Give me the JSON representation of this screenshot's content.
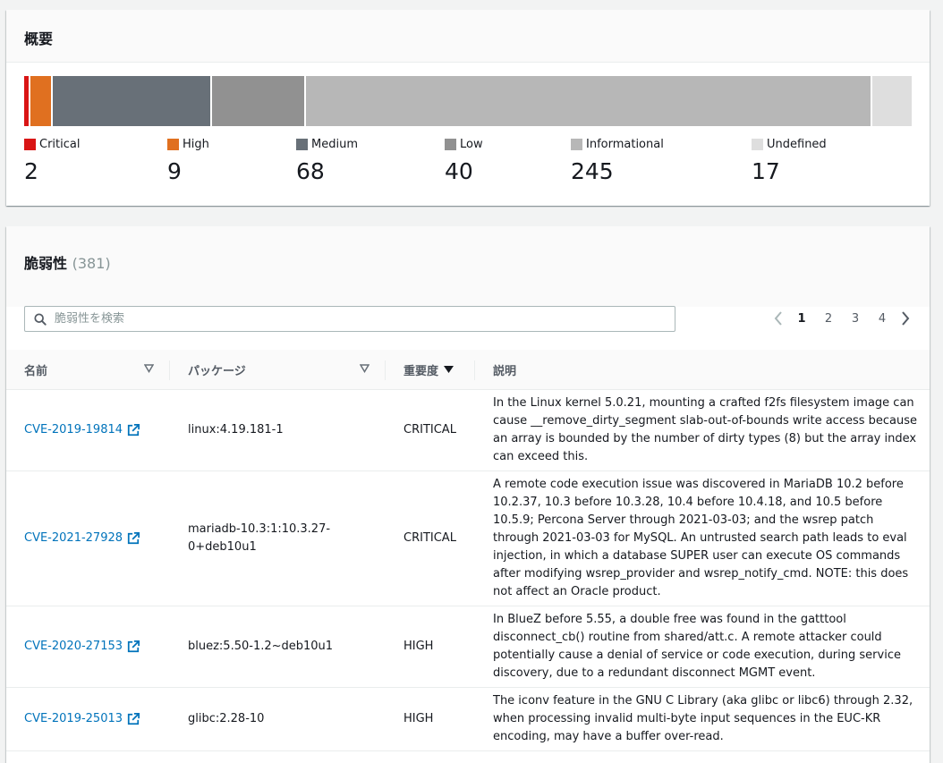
{
  "summary": {
    "title": "概要",
    "segments": [
      {
        "label": "Critical",
        "value": 2,
        "color": "#d91515"
      },
      {
        "label": "High",
        "value": 9,
        "color": "#e07020"
      },
      {
        "label": "Medium",
        "value": 68,
        "color": "#687078"
      },
      {
        "label": "Low",
        "value": 40,
        "color": "#919191"
      },
      {
        "label": "Informational",
        "value": 245,
        "color": "#b7b7b7"
      },
      {
        "label": "Undefined",
        "value": 17,
        "color": "#dedede"
      }
    ],
    "legend": [
      {
        "label": "Critical",
        "value": "2"
      },
      {
        "label": "High",
        "value": "9"
      },
      {
        "label": "Medium",
        "value": "68"
      },
      {
        "label": "Low",
        "value": "40"
      },
      {
        "label": "Informational",
        "value": "245"
      },
      {
        "label": "Undefined",
        "value": "17"
      }
    ]
  },
  "vulns": {
    "title": "脆弱性",
    "count": "(381)",
    "search_placeholder": "脆弱性を検索",
    "pages": [
      "1",
      "2",
      "3",
      "4"
    ],
    "current_page": "1",
    "columns": {
      "name": "名前",
      "package": "パッケージ",
      "severity": "重要度",
      "description": "説明"
    },
    "rows": [
      {
        "name": "CVE-2019-19814",
        "package": "linux:4.19.181-1",
        "severity": "CRITICAL",
        "description": "In the Linux kernel 5.0.21, mounting a crafted f2fs filesystem image can cause __remove_dirty_segment slab-out-of-bounds write access because an array is bounded by the number of dirty types (8) but the array index can exceed this."
      },
      {
        "name": "CVE-2021-27928",
        "package": "mariadb-10.3:1:10.3.27-0+deb10u1",
        "severity": "CRITICAL",
        "description": "A remote code execution issue was discovered in MariaDB 10.2 before 10.2.37, 10.3 before 10.3.28, 10.4 before 10.4.18, and 10.5 before 10.5.9; Percona Server through 2021-03-03; and the wsrep patch through 2021-03-03 for MySQL. An untrusted search path leads to eval injection, in which a database SUPER user can execute OS commands after modifying wsrep_provider and wsrep_notify_cmd. NOTE: this does not affect an Oracle product."
      },
      {
        "name": "CVE-2020-27153",
        "package": "bluez:5.50-1.2~deb10u1",
        "severity": "HIGH",
        "description": "In BlueZ before 5.55, a double free was found in the gatttool disconnect_cb() routine from shared/att.c. A remote attacker could potentially cause a denial of service or code execution, during service discovery, due to a redundant disconnect MGMT event."
      },
      {
        "name": "CVE-2019-25013",
        "package": "glibc:2.28-10",
        "severity": "HIGH",
        "description": "The iconv feature in the GNU C Library (aka glibc or libc6) through 2.32, when processing invalid multi-byte input sequences in the EUC-KR encoding, may have a buffer over-read."
      }
    ]
  }
}
